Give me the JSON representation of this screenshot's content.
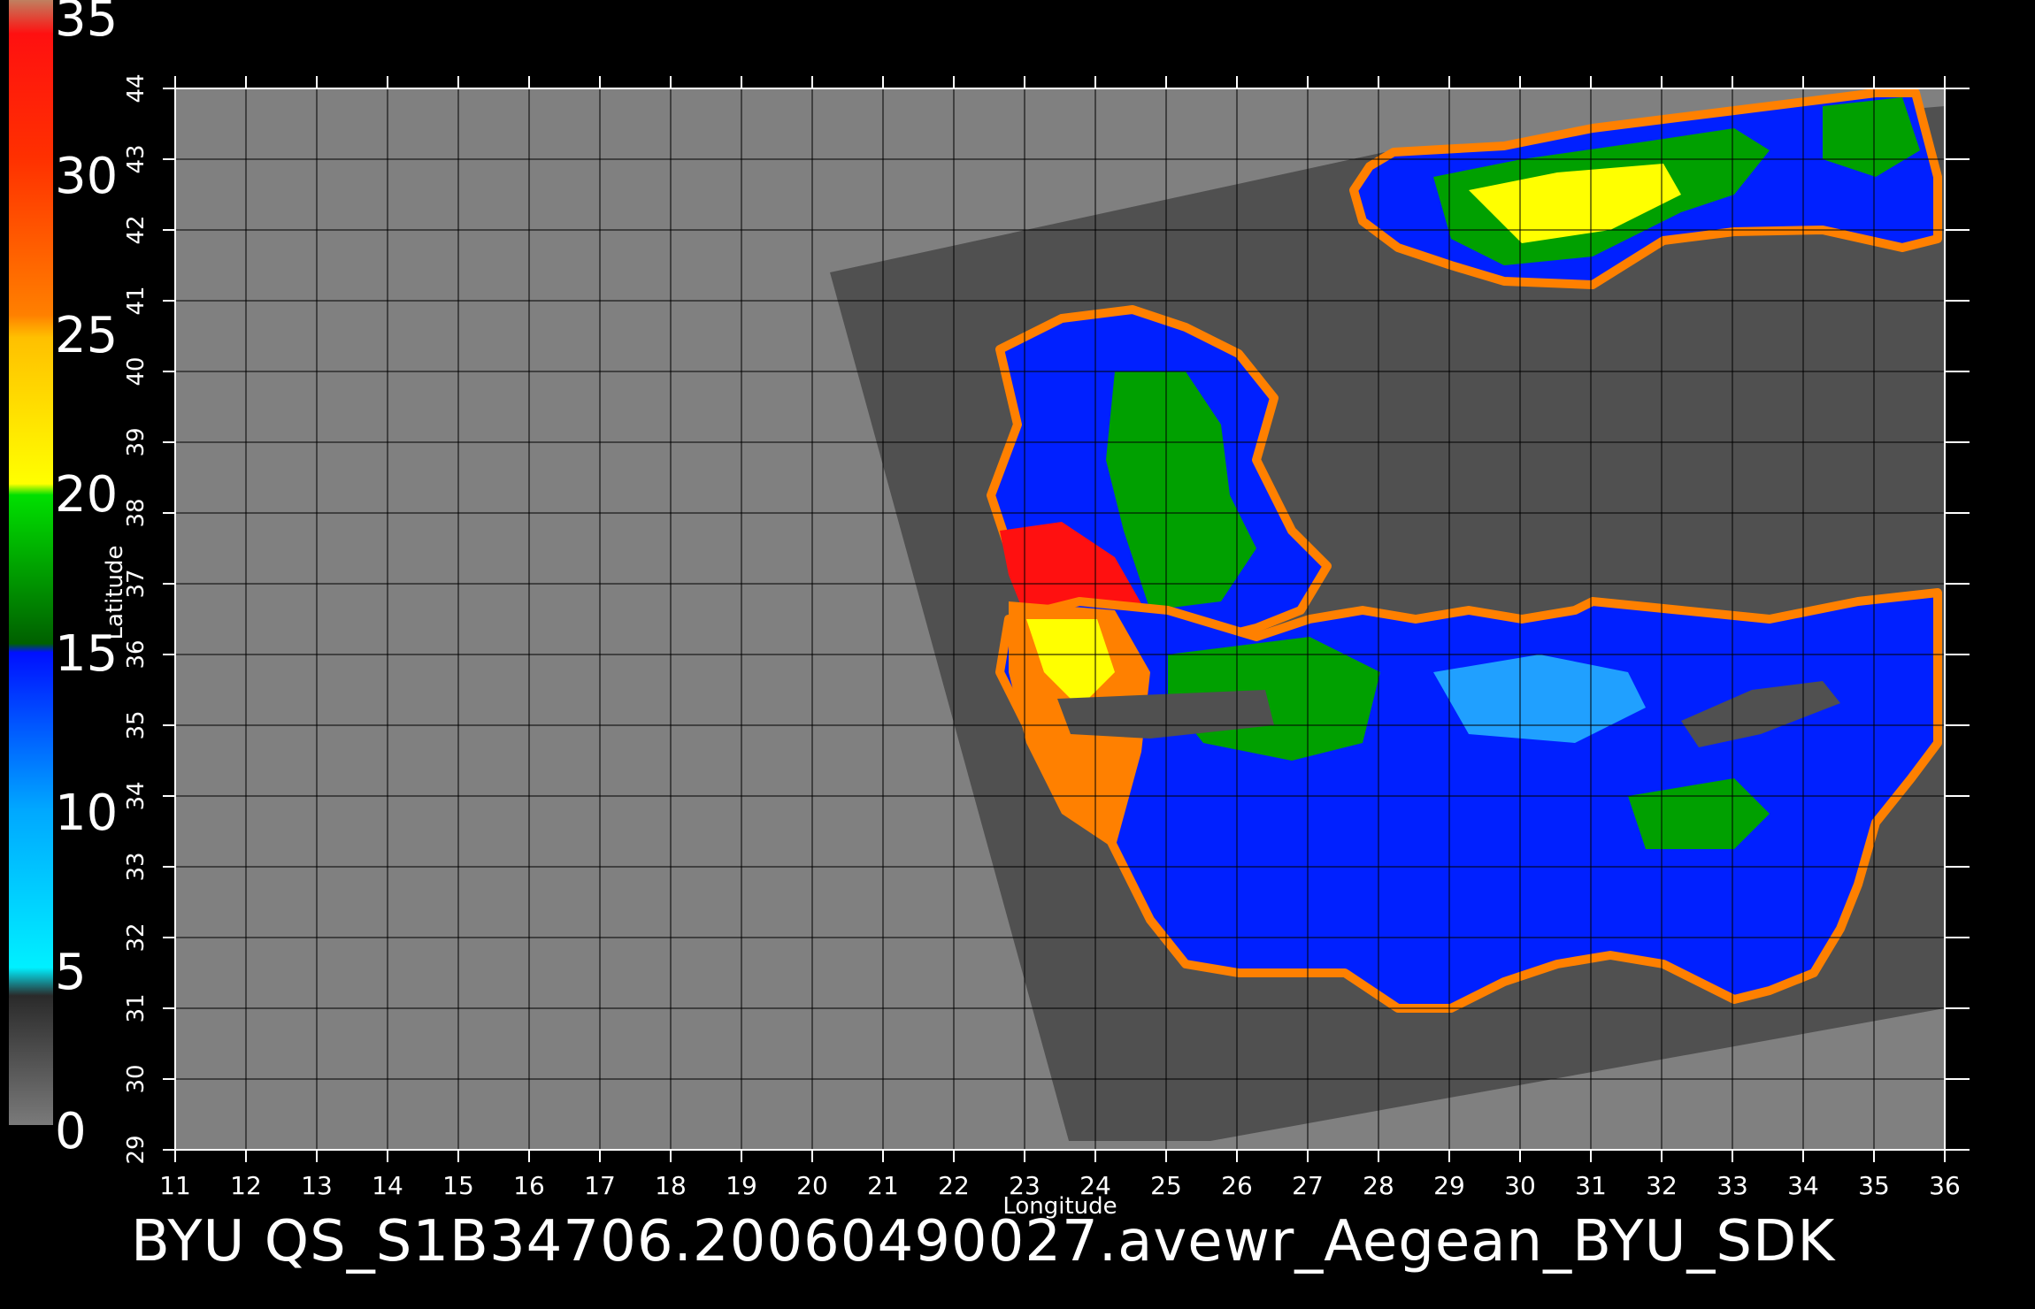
{
  "title": "BYU  QS_S1B34706.20060490027.avewr_Aegean_BYU_SDK",
  "axes": {
    "xlabel": "Longitude",
    "ylabel": "Latitude",
    "xticks": [
      "11",
      "12",
      "13",
      "14",
      "15",
      "16",
      "17",
      "18",
      "19",
      "20",
      "21",
      "22",
      "23",
      "24",
      "25",
      "26",
      "27",
      "28",
      "29",
      "30",
      "31",
      "32",
      "33",
      "34",
      "35",
      "36"
    ],
    "yticks": [
      "29",
      "30",
      "31",
      "32",
      "33",
      "34",
      "35",
      "36",
      "37",
      "38",
      "39",
      "40",
      "41",
      "42",
      "43",
      "44"
    ],
    "xrange": [
      11,
      36
    ],
    "yrange": [
      29,
      44
    ],
    "grid": true
  },
  "colorbar": {
    "labels": [
      "35",
      "30",
      "25",
      "20",
      "15",
      "10",
      "5",
      "0"
    ],
    "range": [
      0,
      35
    ],
    "colors": {
      "low": "#7a7a7a",
      "dark": "#3a3a3a",
      "cyan": "#00e8ff",
      "blue": "#0020ff",
      "green": "#00a000",
      "yellow": "#ffff00",
      "orange": "#ff8000",
      "red": "#ff1010",
      "top": "#c08060"
    }
  },
  "colors": {
    "background": "#000000",
    "map_bg": "#808080",
    "swath": "#505050",
    "grid": "#000000"
  }
}
